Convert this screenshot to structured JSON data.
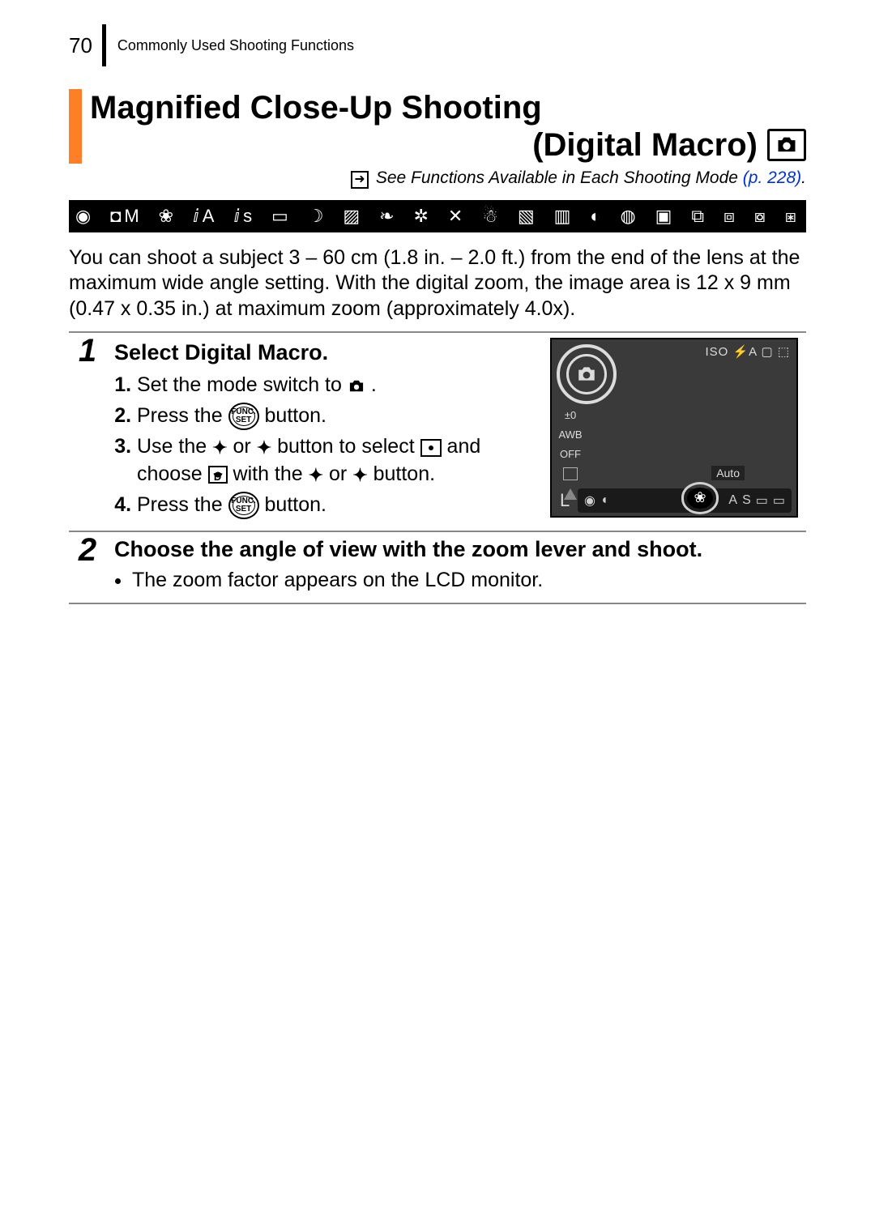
{
  "header": {
    "page_number": "70",
    "chapter_title": "Commonly Used Shooting Functions"
  },
  "section": {
    "title_line1": "Magnified Close-Up Shooting",
    "title_line2": "(Digital Macro)",
    "see_also_prefix": "See Functions Available in Each Shooting Mode",
    "see_also_link": "(p. 228)",
    "see_also_link_period": "."
  },
  "intro": "You can shoot a subject 3 – 60 cm (1.8 in. – 2.0 ft.) from the end of the lens at the maximum wide angle setting. With the digital zoom, the image area is 12 x 9 mm (0.47 x 0.35 in.) at maximum zoom (approximately 4.0x).",
  "steps": [
    {
      "num": "1",
      "title": "Select Digital Macro.",
      "sub": {
        "l1a": "Set the mode switch to ",
        "l1b": ".",
        "l2a": "Press the ",
        "l2b": " button.",
        "l3a": "Use the ",
        "l3b": " or ",
        "l3c": " button to select ",
        "l3d": " and choose ",
        "l3e": " with the ",
        "l3f": " or ",
        "l3g": " button.",
        "l4a": "Press the ",
        "l4b": " button."
      }
    },
    {
      "num": "2",
      "title": "Choose the angle of view with the zoom lever and shoot.",
      "bullet": "The zoom factor appears on the LCD monitor."
    }
  ],
  "lcd": {
    "tr": "ISO ⚡A ▢ ⬚",
    "left": {
      "ev": "±0",
      "awb": "AWB",
      "off": "OFF",
      "box": "▫"
    },
    "auto": "Auto",
    "L": "L",
    "bar": {
      "cam": "◉",
      "movie": "◖",
      "flower": "❀",
      "a": "A",
      "s": "S",
      "p1": "▭",
      "p2": "▭"
    }
  },
  "func_label_top": "FUNC.",
  "func_label_bot": "SET"
}
